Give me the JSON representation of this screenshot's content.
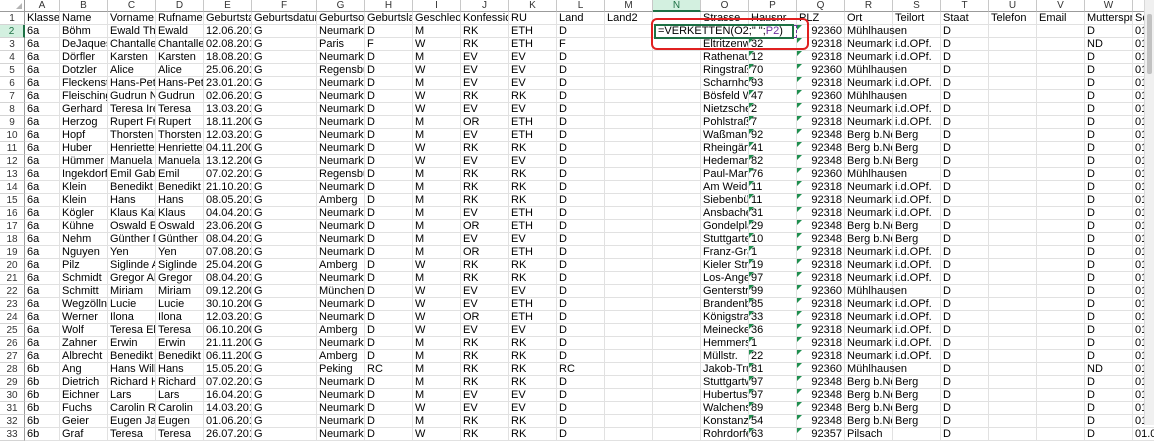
{
  "columns": [
    {
      "letter": "A"
    },
    {
      "letter": "B"
    },
    {
      "letter": "C"
    },
    {
      "letter": "D"
    },
    {
      "letter": "E"
    },
    {
      "letter": "F"
    },
    {
      "letter": "G"
    },
    {
      "letter": "H"
    },
    {
      "letter": "I"
    },
    {
      "letter": "J"
    },
    {
      "letter": "K"
    },
    {
      "letter": "L"
    },
    {
      "letter": "M"
    },
    {
      "letter": "N"
    },
    {
      "letter": "O"
    },
    {
      "letter": "P"
    },
    {
      "letter": "Q"
    },
    {
      "letter": "R"
    },
    {
      "letter": "S"
    },
    {
      "letter": "T"
    },
    {
      "letter": "U"
    },
    {
      "letter": "V"
    },
    {
      "letter": "W"
    },
    {
      "letter": "X"
    }
  ],
  "selected_column": "N",
  "selected_row": "2",
  "active_cell": {
    "ref": "N2",
    "formula_prefix": "=VERKETTEN(O2;\" \";",
    "formula_ref": "P2",
    "formula_suffix": ")"
  },
  "header_row": [
    "Klasse",
    "Name",
    "Vorname",
    "Rufname",
    "Geburtstag",
    "Geburtsdatum",
    "Geburtsort",
    "Geburtslan",
    "Geschlech",
    "Konfession",
    "RU",
    "Land",
    "Land2",
    "",
    "Strasse",
    "Hausnr",
    "PLZ",
    "Ort",
    "Teilort",
    "Staat",
    "Telefon",
    "Email",
    "Mutterspra",
    "Sch"
  ],
  "rows": [
    [
      "6a",
      "Böhm",
      "Ewald Tho",
      "Ewald",
      "12.06.201",
      "G",
      "Neumarkt",
      "D",
      "M",
      "RK",
      "ETH",
      "D",
      "",
      "",
      "",
      "",
      "92360",
      "Mühlhausen",
      "",
      "D",
      "",
      "",
      "D",
      "01.0"
    ],
    [
      "6a",
      "DeJaques",
      "Chantalle",
      "Chantalle",
      "02.08.201",
      "G",
      "Paris",
      "F",
      "W",
      "RK",
      "ETH",
      "F",
      "",
      "",
      "Eltritzenwe",
      "32",
      "92318",
      "Neumarkt",
      "i.d.OPf.",
      "D",
      "",
      "",
      "ND",
      "01.0"
    ],
    [
      "6a",
      "Dörfler",
      "Karsten",
      "Karsten",
      "18.08.201",
      "G",
      "Neumarkt",
      "D",
      "M",
      "EV",
      "EV",
      "D",
      "",
      "",
      "Rathenaus",
      "12",
      "92318",
      "Neumarkt",
      "i.d.OPf.",
      "D",
      "",
      "",
      "D",
      "01.0"
    ],
    [
      "6a",
      "Dotzler",
      "Alice",
      "Alice",
      "25.06.201",
      "G",
      "Regensbur",
      "D",
      "W",
      "EV",
      "EV",
      "D",
      "",
      "",
      "Ringstraße",
      "70",
      "92360",
      "Mühlhausen",
      "",
      "D",
      "",
      "",
      "D",
      "01.0"
    ],
    [
      "6a",
      "Fleckenste",
      "Hans-Pete",
      "Hans-Pete",
      "23.01.201",
      "G",
      "Neumarkt",
      "D",
      "M",
      "EV",
      "EV",
      "D",
      "",
      "",
      "Scharnhor",
      "93",
      "92318",
      "Neumarkt",
      "i.d.OPf.",
      "D",
      "",
      "",
      "D",
      "01.0"
    ],
    [
      "6a",
      "Fleisching",
      "Gudrun Na",
      "Gudrun",
      "02.06.201",
      "G",
      "Neumarkt",
      "D",
      "W",
      "RK",
      "RK",
      "D",
      "",
      "",
      "Bösfeld W",
      "47",
      "92360",
      "Mühlhausen",
      "",
      "D",
      "",
      "",
      "D",
      "01.0"
    ],
    [
      "6a",
      "Gerhard",
      "Teresa Irer",
      "Teresa",
      "13.03.201",
      "G",
      "Neumarkt",
      "D",
      "W",
      "EV",
      "EV",
      "D",
      "",
      "",
      "Nietzschen",
      "2",
      "92318",
      "Neumarkt",
      "i.d.OPf.",
      "D",
      "",
      "",
      "D",
      "01.0"
    ],
    [
      "6a",
      "Herzog",
      "Rupert Fra",
      "Rupert",
      "18.11.200",
      "G",
      "Neumarkt",
      "D",
      "M",
      "OR",
      "ETH",
      "D",
      "",
      "",
      "Pohlstraße",
      "7",
      "92318",
      "Neumarkt",
      "i.d.OPf.",
      "D",
      "",
      "",
      "D",
      "01.0"
    ],
    [
      "6a",
      "Hopf",
      "Thorsten D",
      "Thorsten",
      "12.03.201",
      "G",
      "Neumarkt",
      "D",
      "M",
      "EV",
      "ETH",
      "D",
      "",
      "",
      "Waßmann",
      "92",
      "92348",
      "Berg b.Ne",
      "Berg",
      "D",
      "",
      "",
      "D",
      "01.0"
    ],
    [
      "6a",
      "Huber",
      "Henriette E",
      "Henriette",
      "04.11.200",
      "G",
      "Neumarkt",
      "D",
      "W",
      "RK",
      "RK",
      "D",
      "",
      "",
      "Rheingärte",
      "41",
      "92348",
      "Berg b.Ne",
      "Berg",
      "D",
      "",
      "",
      "D",
      "01.0"
    ],
    [
      "6a",
      "Hümmer",
      "Manuela",
      "Manuela",
      "13.12.200",
      "G",
      "Neumarkt",
      "D",
      "W",
      "EV",
      "EV",
      "D",
      "",
      "",
      "Hedemann",
      "82",
      "92348",
      "Berg b.Ne",
      "Berg",
      "D",
      "",
      "",
      "D",
      "01.0"
    ],
    [
      "6a",
      "Ingekdorf",
      "Emil Gabri",
      "Emil",
      "07.02.201",
      "G",
      "Regensbur",
      "D",
      "M",
      "RK",
      "RK",
      "D",
      "",
      "",
      "Paul-Martir",
      "76",
      "92360",
      "Mühlhausen",
      "",
      "D",
      "",
      "",
      "D",
      "01.0"
    ],
    [
      "6a",
      "Klein",
      "Benedikt F",
      "Benedikt",
      "21.10.201",
      "G",
      "Neumarkt",
      "D",
      "M",
      "RK",
      "RK",
      "D",
      "",
      "",
      "Am Weide",
      "11",
      "92318",
      "Neumarkt",
      "i.d.OPf.",
      "D",
      "",
      "",
      "D",
      "01.0"
    ],
    [
      "6a",
      "Klein",
      "Hans",
      "Hans",
      "08.05.201",
      "G",
      "Amberg",
      "D",
      "M",
      "RK",
      "RK",
      "D",
      "",
      "",
      "Siebenbür",
      "11",
      "92318",
      "Neumarkt",
      "i.d.OPf.",
      "D",
      "",
      "",
      "D",
      "01.0"
    ],
    [
      "6a",
      "Kögler",
      "Klaus Kai",
      "Klaus",
      "04.04.201",
      "G",
      "Neumarkt",
      "D",
      "M",
      "EV",
      "ETH",
      "D",
      "",
      "",
      "Ansbacher",
      "31",
      "92318",
      "Neumarkt",
      "i.d.OPf.",
      "D",
      "",
      "",
      "D",
      "01.0"
    ],
    [
      "6a",
      "Kühne",
      "Oswald Ec",
      "Oswald",
      "23.06.200",
      "G",
      "Neumarkt",
      "D",
      "M",
      "OR",
      "ETH",
      "D",
      "",
      "",
      "Gondelplat",
      "29",
      "92348",
      "Berg b.Ne",
      "Berg",
      "D",
      "",
      "",
      "D",
      "01.0"
    ],
    [
      "6a",
      "Nehm",
      "Günther N",
      "Günther",
      "08.04.201",
      "G",
      "Neumarkt",
      "D",
      "M",
      "EV",
      "EV",
      "D",
      "",
      "",
      "Stuttgarter",
      "10",
      "92348",
      "Berg b.Ne",
      "Berg",
      "D",
      "",
      "",
      "D",
      "01.0"
    ],
    [
      "6a",
      "Nguyen",
      "Yen",
      "Yen",
      "07.08.201",
      "G",
      "Neumarkt",
      "D",
      "M",
      "OR",
      "ETH",
      "D",
      "",
      "",
      "Franz-Gras",
      "1",
      "92318",
      "Neumarkt",
      "i.d.OPf.",
      "D",
      "",
      "",
      "D",
      "01.0"
    ],
    [
      "6a",
      "Pilz",
      "Siglinde Al",
      "Siglinde",
      "25.04.200",
      "G",
      "Amberg",
      "D",
      "W",
      "RK",
      "RK",
      "D",
      "",
      "",
      "Kieler Stra",
      "19",
      "92318",
      "Neumarkt",
      "i.d.OPf.",
      "D",
      "",
      "",
      "D",
      "01.0"
    ],
    [
      "6a",
      "Schmidt",
      "Gregor Ale",
      "Gregor",
      "08.04.201",
      "G",
      "Neumarkt",
      "D",
      "M",
      "RK",
      "RK",
      "D",
      "",
      "",
      "Los-Angele",
      "97",
      "92318",
      "Neumarkt",
      "i.d.OPf.",
      "D",
      "",
      "",
      "D",
      "01.0"
    ],
    [
      "6a",
      "Schmitt",
      "Miriam",
      "Miriam",
      "09.12.200",
      "G",
      "München",
      "D",
      "W",
      "EV",
      "EV",
      "D",
      "",
      "",
      "Genterstra",
      "99",
      "92360",
      "Mühlhausen",
      "",
      "D",
      "",
      "",
      "D",
      "01.0"
    ],
    [
      "6a",
      "Wegzöllne",
      "Lucie",
      "Lucie",
      "30.10.200",
      "G",
      "Neumarkt",
      "D",
      "W",
      "EV",
      "ETH",
      "D",
      "",
      "",
      "Brandenbu",
      "85",
      "92318",
      "Neumarkt",
      "i.d.OPf.",
      "D",
      "",
      "",
      "D",
      "01.0"
    ],
    [
      "6a",
      "Werner",
      "Ilona",
      "Ilona",
      "12.03.201",
      "G",
      "Neumarkt",
      "D",
      "W",
      "OR",
      "ETH",
      "D",
      "",
      "",
      "Königstraß",
      "33",
      "92318",
      "Neumarkt",
      "i.d.OPf.",
      "D",
      "",
      "",
      "D",
      "01.0"
    ],
    [
      "6a",
      "Wolf",
      "Teresa Ele",
      "Teresa",
      "06.10.200",
      "G",
      "Amberg",
      "D",
      "W",
      "EV",
      "EV",
      "D",
      "",
      "",
      "Meineckes",
      "36",
      "92318",
      "Neumarkt",
      "i.d.OPf.",
      "D",
      "",
      "",
      "D",
      "01.0"
    ],
    [
      "6a",
      "Zahner",
      "Erwin",
      "Erwin",
      "21.11.200",
      "G",
      "Neumarkt",
      "D",
      "M",
      "RK",
      "RK",
      "D",
      "",
      "",
      "Hemmerst",
      "1",
      "92318",
      "Neumarkt",
      "i.d.OPf.",
      "D",
      "",
      "",
      "D",
      "01.0"
    ],
    [
      "6a",
      "Albrecht",
      "Benedikt G",
      "Benedikt",
      "06.11.200",
      "G",
      "Amberg",
      "D",
      "M",
      "RK",
      "RK",
      "D",
      "",
      "",
      "Müllstr.",
      "22",
      "92318",
      "Neumarkt",
      "i.d.OPf.",
      "D",
      "",
      "",
      "D",
      "01.0"
    ],
    [
      "6b",
      "Ang",
      "Hans Willi",
      "Hans",
      "15.05.201",
      "G",
      "Peking",
      "RC",
      "M",
      "RK",
      "RK",
      "RC",
      "",
      "",
      "Jakob-Trur",
      "81",
      "92360",
      "Mühlhausen",
      "",
      "D",
      "",
      "",
      "ND",
      "01.0"
    ],
    [
      "6b",
      "Dietrich",
      "Richard Ha",
      "Richard",
      "07.02.201",
      "G",
      "Neumarkt",
      "D",
      "M",
      "RK",
      "RK",
      "D",
      "",
      "",
      "Stuttgartw",
      "97",
      "92348",
      "Berg b.Ne",
      "Berg",
      "D",
      "",
      "",
      "D",
      "01.0"
    ],
    [
      "6b",
      "Eichner",
      "Lars",
      "Lars",
      "16.04.201",
      "G",
      "Neumarkt",
      "D",
      "M",
      "EV",
      "EV",
      "D",
      "",
      "",
      "Hubertusw",
      "97",
      "92348",
      "Berg b.Ne",
      "Berg",
      "D",
      "",
      "",
      "D",
      "01.0"
    ],
    [
      "6b",
      "Fuchs",
      "Carolin Ro",
      "Carolin",
      "14.03.201",
      "G",
      "Neumarkt",
      "D",
      "W",
      "EV",
      "EV",
      "D",
      "",
      "",
      "Walchens",
      "89",
      "92348",
      "Berg b.Ne",
      "Berg",
      "D",
      "",
      "",
      "D",
      "01.0"
    ],
    [
      "6b",
      "Geier",
      "Eugen Jak",
      "Eugen",
      "01.06.201",
      "G",
      "Neumarkt",
      "D",
      "M",
      "RK",
      "RK",
      "D",
      "",
      "",
      "Konstanze",
      "54",
      "92348",
      "Berg b.Ne",
      "Berg",
      "D",
      "",
      "",
      "D",
      "01.0"
    ],
    [
      "6b",
      "Graf",
      "Teresa",
      "Teresa",
      "26.07.201",
      "G",
      "Neumarkt",
      "D",
      "W",
      "RK",
      "RK",
      "D",
      "",
      "",
      "Rohrdorfer",
      "63",
      "92357",
      "Pilsach",
      "",
      "D",
      "",
      "",
      "D",
      "01.0"
    ]
  ]
}
